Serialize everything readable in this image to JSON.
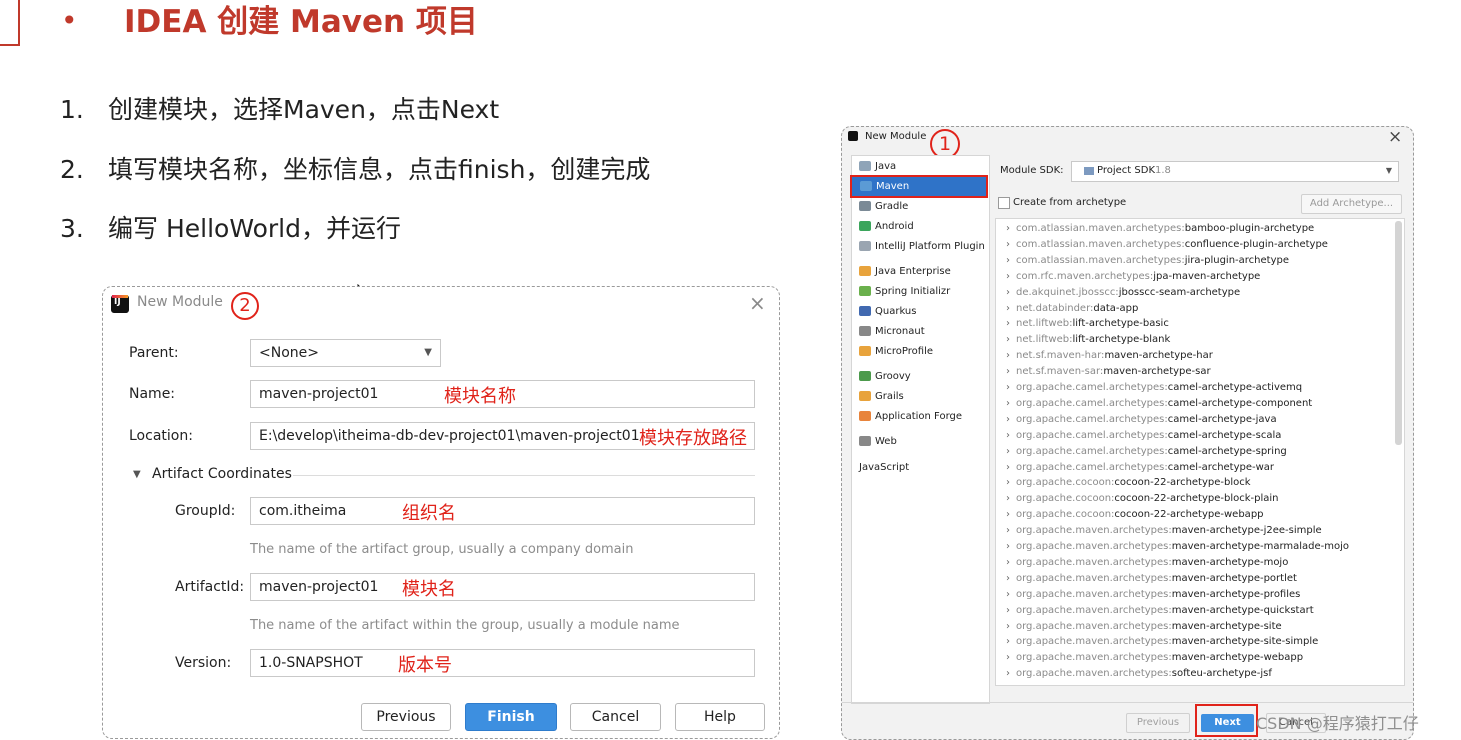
{
  "slide": {
    "bullet": "•",
    "title": "IDEA 创建 Maven 项目",
    "steps": [
      {
        "num": "1.",
        "text": "创建模块，选择Maven，点击Next"
      },
      {
        "num": "2.",
        "text": "填写模块名称，坐标信息，点击finish，创建完成"
      },
      {
        "num": "3.",
        "text": "编写 HelloWorld，并运行"
      }
    ]
  },
  "dialog2": {
    "title": "New Module",
    "badge": "②",
    "close": "×",
    "parent_label": "Parent:",
    "parent_value": "<None>",
    "name_label": "Name:",
    "name_value": "maven-project01",
    "name_note": "模块名称",
    "location_label": "Location:",
    "location_value": "E:\\develop\\itheima-db-dev-project01\\maven-project01",
    "location_note": "模块存放路径",
    "artifact_section": "Artifact Coordinates",
    "groupid_label": "GroupId:",
    "groupid_value": "com.itheima",
    "groupid_note": "组织名",
    "groupid_hint": "The name of the artifact group, usually a company domain",
    "artifactid_label": "ArtifactId:",
    "artifactid_value": "maven-project01",
    "artifactid_note": "模块名",
    "artifactid_hint": "The name of the artifact within the group, usually a module name",
    "version_label": "Version:",
    "version_value": "1.0-SNAPSHOT",
    "version_note": "版本号",
    "buttons": {
      "previous": "Previous",
      "finish": "Finish",
      "cancel": "Cancel",
      "help": "Help"
    }
  },
  "dialog1": {
    "title": "New Module",
    "badge": "①",
    "close": "×",
    "categories": [
      {
        "label": "Java",
        "icon": "folder-icon",
        "color": "#8fa4b8"
      },
      {
        "label": "Maven",
        "icon": "maven-icon",
        "color": "#5b9bd5"
      },
      {
        "label": "Gradle",
        "icon": "gradle-icon",
        "color": "#7b8a96"
      },
      {
        "label": "Android",
        "icon": "android-icon",
        "color": "#3ba55c"
      },
      {
        "label": "IntelliJ Platform Plugin",
        "icon": "plugin-icon",
        "color": "#9aa5b1"
      },
      {
        "label": "Java Enterprise",
        "icon": "java-ee-icon",
        "color": "#e8a33c"
      },
      {
        "label": "Spring Initializr",
        "icon": "spring-icon",
        "color": "#6ab04c"
      },
      {
        "label": "Quarkus",
        "icon": "quarkus-icon",
        "color": "#4169b0"
      },
      {
        "label": "Micronaut",
        "icon": "micronaut-icon",
        "color": "#888888"
      },
      {
        "label": "MicroProfile",
        "icon": "microprofile-icon",
        "color": "#e8a33c"
      },
      {
        "label": "Groovy",
        "icon": "groovy-icon",
        "color": "#4c9a4c"
      },
      {
        "label": "Grails",
        "icon": "grails-icon",
        "color": "#e8a33c"
      },
      {
        "label": "Application Forge",
        "icon": "forge-icon",
        "color": "#e8843c"
      },
      {
        "label": "Web",
        "icon": "globe-icon",
        "color": "#888888"
      },
      {
        "label": "JavaScript",
        "icon": "",
        "color": ""
      }
    ],
    "sdk_label": "Module SDK:",
    "sdk_value": "Project SDK",
    "sdk_version": "1.8",
    "create_from_archetype": "Create from archetype",
    "add_archetype": "Add Archetype...",
    "archetypes": [
      {
        "group": "com.atlassian.maven.archetypes:",
        "name": "bamboo-plugin-archetype"
      },
      {
        "group": "com.atlassian.maven.archetypes:",
        "name": "confluence-plugin-archetype"
      },
      {
        "group": "com.atlassian.maven.archetypes:",
        "name": "jira-plugin-archetype"
      },
      {
        "group": "com.rfc.maven.archetypes:",
        "name": "jpa-maven-archetype"
      },
      {
        "group": "de.akquinet.jbosscc:",
        "name": "jbosscc-seam-archetype"
      },
      {
        "group": "net.databinder:",
        "name": "data-app"
      },
      {
        "group": "net.liftweb:",
        "name": "lift-archetype-basic"
      },
      {
        "group": "net.liftweb:",
        "name": "lift-archetype-blank"
      },
      {
        "group": "net.sf.maven-har:",
        "name": "maven-archetype-har"
      },
      {
        "group": "net.sf.maven-sar:",
        "name": "maven-archetype-sar"
      },
      {
        "group": "org.apache.camel.archetypes:",
        "name": "camel-archetype-activemq"
      },
      {
        "group": "org.apache.camel.archetypes:",
        "name": "camel-archetype-component"
      },
      {
        "group": "org.apache.camel.archetypes:",
        "name": "camel-archetype-java"
      },
      {
        "group": "org.apache.camel.archetypes:",
        "name": "camel-archetype-scala"
      },
      {
        "group": "org.apache.camel.archetypes:",
        "name": "camel-archetype-spring"
      },
      {
        "group": "org.apache.camel.archetypes:",
        "name": "camel-archetype-war"
      },
      {
        "group": "org.apache.cocoon:",
        "name": "cocoon-22-archetype-block"
      },
      {
        "group": "org.apache.cocoon:",
        "name": "cocoon-22-archetype-block-plain"
      },
      {
        "group": "org.apache.cocoon:",
        "name": "cocoon-22-archetype-webapp"
      },
      {
        "group": "org.apache.maven.archetypes:",
        "name": "maven-archetype-j2ee-simple"
      },
      {
        "group": "org.apache.maven.archetypes:",
        "name": "maven-archetype-marmalade-mojo"
      },
      {
        "group": "org.apache.maven.archetypes:",
        "name": "maven-archetype-mojo"
      },
      {
        "group": "org.apache.maven.archetypes:",
        "name": "maven-archetype-portlet"
      },
      {
        "group": "org.apache.maven.archetypes:",
        "name": "maven-archetype-profiles"
      },
      {
        "group": "org.apache.maven.archetypes:",
        "name": "maven-archetype-quickstart"
      },
      {
        "group": "org.apache.maven.archetypes:",
        "name": "maven-archetype-site"
      },
      {
        "group": "org.apache.maven.archetypes:",
        "name": "maven-archetype-site-simple"
      },
      {
        "group": "org.apache.maven.archetypes:",
        "name": "maven-archetype-webapp"
      },
      {
        "group": "org.apache.maven.archetypes:",
        "name": "softeu-archetype-jsf"
      }
    ],
    "buttons": {
      "previous": "Previous",
      "next": "Next",
      "cancel": "Cancel"
    }
  },
  "watermark": "CSDN @程序猿打工仔",
  "colors": {
    "accent_red": "#c0392b",
    "annotation_red": "#e0231a",
    "selection_blue": "#2f73c8",
    "primary_button": "#3d8fe0"
  }
}
